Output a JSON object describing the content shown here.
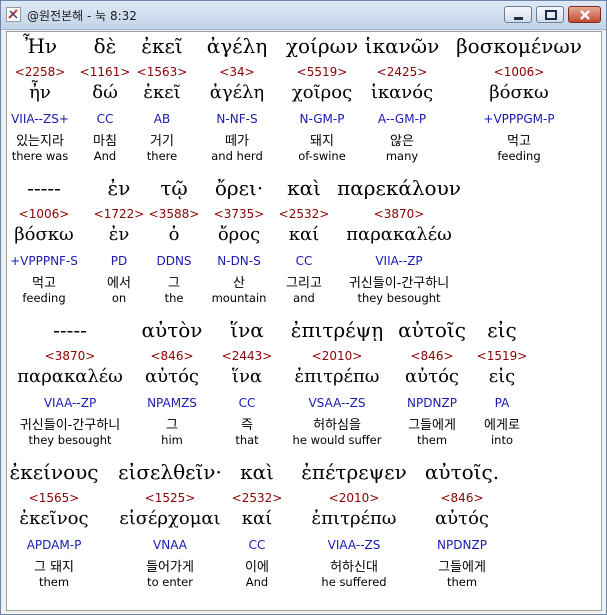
{
  "window": {
    "title": "@원전본해 - 눅 8:32"
  },
  "rows": [
    {
      "words": [
        {
          "greek": "Ἦν",
          "strong": "<2258>",
          "lemma": "ἦν",
          "parse": "VIIA--ZS+",
          "korean": "있는지라",
          "english": "there was"
        },
        {
          "greek": "δὲ",
          "strong": "<1161>",
          "lemma": "δώ",
          "parse": "CC",
          "korean": "마침",
          "english": "And"
        },
        {
          "greek": "ἐκεῖ",
          "strong": "<1563>",
          "lemma": "ἐκεῖ",
          "parse": "AB",
          "korean": "거기",
          "english": "there"
        },
        {
          "greek": "ἀγέλη",
          "strong": "<34>",
          "lemma": "ἀγέλη",
          "parse": "N-NF-S",
          "korean": "떼가",
          "english": "and herd"
        },
        {
          "greek": "χοίρων",
          "strong": "<5519>",
          "lemma": "χοῖρος",
          "parse": "N-GM-P",
          "korean": "돼지",
          "english": "of-swine"
        },
        {
          "greek": "ἱκανῶν",
          "strong": "<2425>",
          "lemma": "ἱκανός",
          "parse": "A--GM-P",
          "korean": "않은",
          "english": "many"
        },
        {
          "greek": "βοσκομένων",
          "strong": "<1006>",
          "lemma": "βόσκω",
          "parse": "+VPPPGM-P",
          "korean": "먹고",
          "english": "feeding"
        }
      ]
    },
    {
      "words": [
        {
          "greek": "-----",
          "strong": "<1006>",
          "lemma": "βόσκω",
          "parse": "+VPPPNF-S",
          "korean": "먹고",
          "english": "feeding"
        },
        {
          "greek": "ἐν",
          "strong": "<1722>",
          "lemma": "ἐν",
          "parse": "PD",
          "korean": "에서",
          "english": "on"
        },
        {
          "greek": "τῷ",
          "strong": "<3588>",
          "lemma": "ὁ",
          "parse": "DDNS",
          "korean": "그",
          "english": "the"
        },
        {
          "greek": "ὄρει·",
          "strong": "<3735>",
          "lemma": "ὄρος",
          "parse": "N-DN-S",
          "korean": "산",
          "english": "mountain"
        },
        {
          "greek": "καὶ",
          "strong": "<2532>",
          "lemma": "καί",
          "parse": "CC",
          "korean": "그리고",
          "english": "and"
        },
        {
          "greek": "παρεκάλουν",
          "strong": "<3870>",
          "lemma": "παρακαλέω",
          "parse": "VIIA--ZP",
          "korean": "귀신들이-간구하니",
          "english": "they besought"
        }
      ]
    },
    {
      "words": [
        {
          "greek": "-----",
          "strong": "<3870>",
          "lemma": "παρακαλέω",
          "parse": "VIAA--ZP",
          "korean": "귀신들이-간구하니",
          "english": "they besought"
        },
        {
          "greek": "αὐτὸν",
          "strong": "<846>",
          "lemma": "αὐτός",
          "parse": "NPAMZS",
          "korean": "그",
          "english": "him"
        },
        {
          "greek": "ἵνα",
          "strong": "<2443>",
          "lemma": "ἵνα",
          "parse": "CC",
          "korean": "즉",
          "english": "that"
        },
        {
          "greek": "ἐπιτρέψῃ",
          "strong": "<2010>",
          "lemma": "ἐπιτρέπω",
          "parse": "VSAA--ZS",
          "korean": "허하심을",
          "english": "he would suffer"
        },
        {
          "greek": "αὐτοῖς",
          "strong": "<846>",
          "lemma": "αὐτός",
          "parse": "NPDNZP",
          "korean": "그들에게",
          "english": "them"
        },
        {
          "greek": "εἰς",
          "strong": "<1519>",
          "lemma": "εἰς",
          "parse": "PA",
          "korean": "에게로",
          "english": "into"
        }
      ]
    },
    {
      "words": [
        {
          "greek": "ἐκείνους",
          "strong": "<1565>",
          "lemma": "ἐκεῖνος",
          "parse": "APDAM-P",
          "korean": "그 돼지",
          "english": "them"
        },
        {
          "greek": "εἰσελθεῖν·",
          "strong": "<1525>",
          "lemma": "εἰσέρχομαι",
          "parse": "VNAA",
          "korean": "들어가게",
          "english": "to enter"
        },
        {
          "greek": "καὶ",
          "strong": "<2532>",
          "lemma": "καί",
          "parse": "CC",
          "korean": "이에",
          "english": "And"
        },
        {
          "greek": "ἐπέτρεψεν",
          "strong": "<2010>",
          "lemma": "ἐπιτρέπω",
          "parse": "VIAA--ZS",
          "korean": "허하신대",
          "english": "he suffered"
        },
        {
          "greek": "αὐτοῖς.",
          "strong": "<846>",
          "lemma": "αὐτός",
          "parse": "NPDNZP",
          "korean": "그들에게",
          "english": "them"
        }
      ]
    }
  ]
}
